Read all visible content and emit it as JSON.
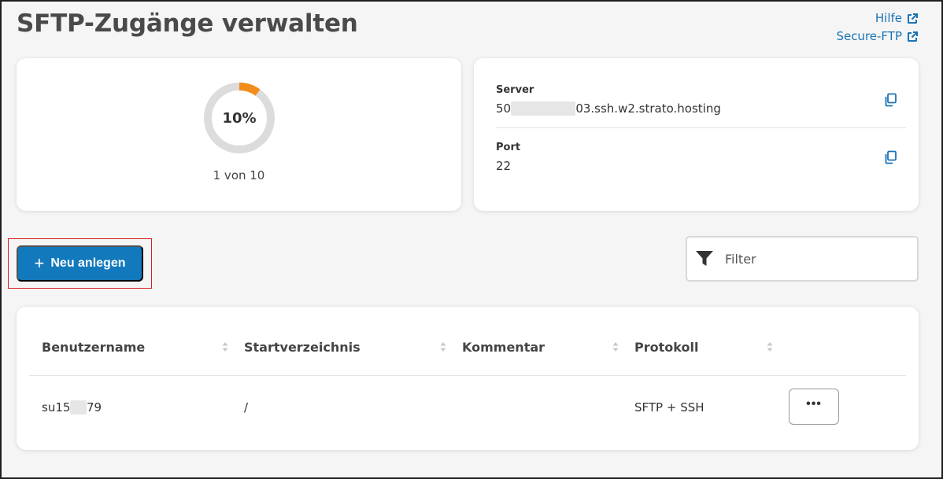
{
  "page": {
    "title": "SFTP-Zugänge verwalten",
    "links": [
      {
        "label": "Hilfe",
        "icon": "external-link-icon"
      },
      {
        "label": "Secure-FTP",
        "icon": "external-link-icon"
      }
    ]
  },
  "usage": {
    "percent_label": "10%",
    "fraction": 0.1,
    "count_label": "1 von 10",
    "accent_color": "#f28c1a"
  },
  "server_info": {
    "server_label": "Server",
    "server_value_prefix": "50",
    "server_value_suffix": "03.ssh.w2.strato.hosting",
    "port_label": "Port",
    "port_value": "22",
    "copy_icon": "copy-icon"
  },
  "actions": {
    "new_button_label": "Neu anlegen",
    "filter_placeholder": "Filter",
    "filter_icon": "filter-icon"
  },
  "table": {
    "columns": [
      "Benutzername",
      "Startverzeichnis",
      "Kommentar",
      "Protokoll"
    ],
    "rows": [
      {
        "username_prefix": "su15",
        "username_suffix": "79",
        "start_dir": "/",
        "comment": "",
        "protocol": "SFTP + SSH",
        "more_label": "•••"
      }
    ]
  },
  "colors": {
    "primary": "#1379bd",
    "link": "#1a73b5",
    "highlight": "#d61f1f"
  }
}
